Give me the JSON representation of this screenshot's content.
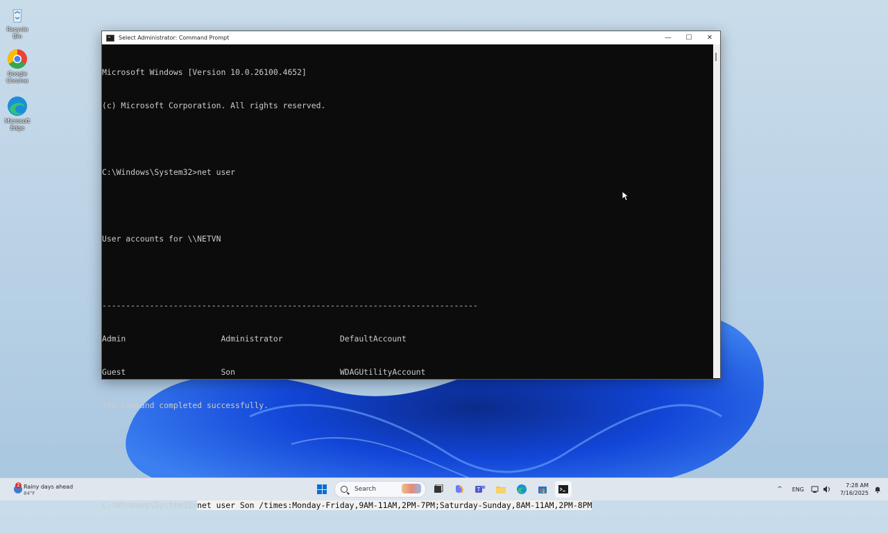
{
  "desktop": {
    "icons": [
      {
        "label": "Recycle Bin",
        "icon": "recycle-bin-icon"
      },
      {
        "label": "Google Chrome",
        "icon": "chrome-icon"
      },
      {
        "label": "Microsoft Edge",
        "icon": "edge-icon"
      }
    ]
  },
  "window": {
    "title": "Select Administrator: Command Prompt",
    "minimize_glyph": "—",
    "maximize_glyph": "☐",
    "close_glyph": "✕"
  },
  "console": {
    "lines": [
      "Microsoft Windows [Version 10.0.26100.4652]",
      "(c) Microsoft Corporation. All rights reserved.",
      "",
      "C:\\Windows\\System32>net user",
      "",
      "User accounts for \\\\NETVN",
      "",
      "-------------------------------------------------------------------------------",
      "Admin                    Administrator            DefaultAccount",
      "Guest                    Son                      WDAGUtilityAccount",
      "The command completed successfully.",
      "",
      ""
    ],
    "prompt": "C:\\Windows\\System32>",
    "typed_command": "net user Son /times:Monday-Friday,9AM-11AM,2PM-7PM;Saturday-Sunday,8AM-11AM,2PM-8PM"
  },
  "taskbar": {
    "weather": {
      "title": "Rainy days ahead",
      "temp": "84°F",
      "badge": "2"
    },
    "search_label": "Search",
    "apps": [
      "file-explorer-icon",
      "copilot-icon",
      "teams-icon",
      "folder-icon",
      "edge-icon",
      "store-icon",
      "terminal-icon"
    ],
    "tray": {
      "chevron": "^",
      "lang": "ENG",
      "time": "7:28 AM",
      "date": "7/16/2025"
    }
  },
  "colors": {
    "console_bg": "#0c0c0c",
    "console_fg": "#cccccc",
    "selection_bg": "#f2f2f2",
    "accent": "#0a6ed1"
  }
}
